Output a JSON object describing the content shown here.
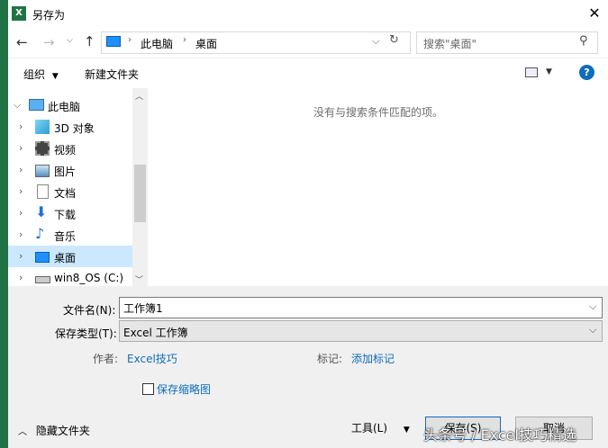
{
  "window": {
    "title": "另存为"
  },
  "nav": {
    "breadcrumb": [
      "此电脑",
      "桌面"
    ],
    "search_placeholder": "搜索\"桌面\""
  },
  "toolbar": {
    "organize": "组织",
    "new_folder": "新建文件夹"
  },
  "tree": {
    "root": "此电脑",
    "items": [
      {
        "label": "3D 对象",
        "icon": "3d-objects-icon"
      },
      {
        "label": "视频",
        "icon": "video-icon"
      },
      {
        "label": "图片",
        "icon": "pictures-icon"
      },
      {
        "label": "文档",
        "icon": "documents-icon"
      },
      {
        "label": "下载",
        "icon": "downloads-icon"
      },
      {
        "label": "音乐",
        "icon": "music-icon"
      },
      {
        "label": "桌面",
        "icon": "desktop-icon",
        "selected": true
      },
      {
        "label": "win8_OS (C:)",
        "icon": "drive-icon"
      }
    ]
  },
  "content": {
    "empty_message": "没有与搜索条件匹配的项。"
  },
  "form": {
    "filename_label": "文件名(N):",
    "filename_value": "工作簿1",
    "filetype_label": "保存类型(T):",
    "filetype_value": "Excel 工作簿",
    "author_label": "作者:",
    "author_value": "Excel技巧",
    "tags_label": "标记:",
    "tags_value": "添加标记",
    "thumbnail_label": "保存缩略图"
  },
  "footer": {
    "hide_folders": "隐藏文件夹",
    "tools": "工具(L)",
    "save": "保存(S)",
    "cancel": "取消"
  },
  "watermark": "头条号 / Excel技巧精选",
  "colors": {
    "accent": "#0f6cbd",
    "excel": "#217346",
    "selected": "#cce8ff"
  }
}
